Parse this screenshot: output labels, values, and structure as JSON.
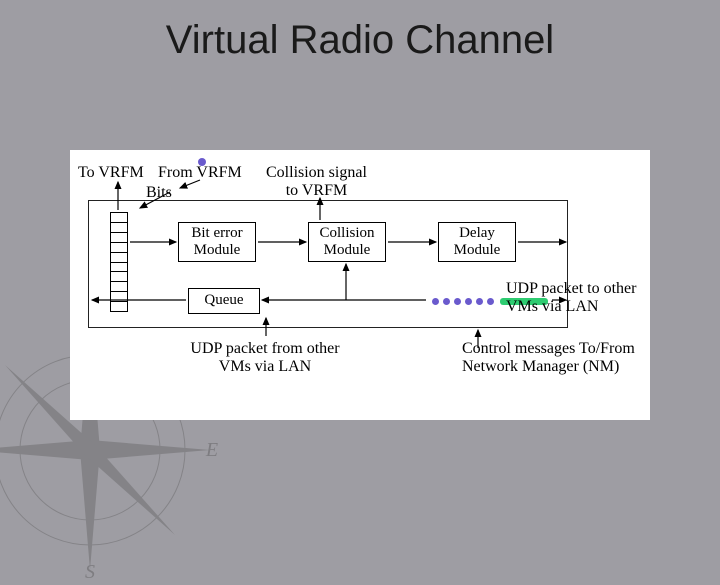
{
  "title": "Virtual Radio Channel",
  "labels": {
    "to_vrfm": "To VRFM",
    "from_vrfm": "From VRFM",
    "bits": "Bits",
    "collision_signal": "Collision signal\nto VRFM",
    "bit_error": "Bit error\nModule",
    "collision_module": "Collision\nModule",
    "delay_module": "Delay\nModule",
    "queue": "Queue",
    "udp_to": "UDP packet to other\nVMs via LAN",
    "udp_from": "UDP packet from other\nVMs via LAN",
    "control_msgs": "Control messages To/From\nNetwork Manager (NM)"
  }
}
